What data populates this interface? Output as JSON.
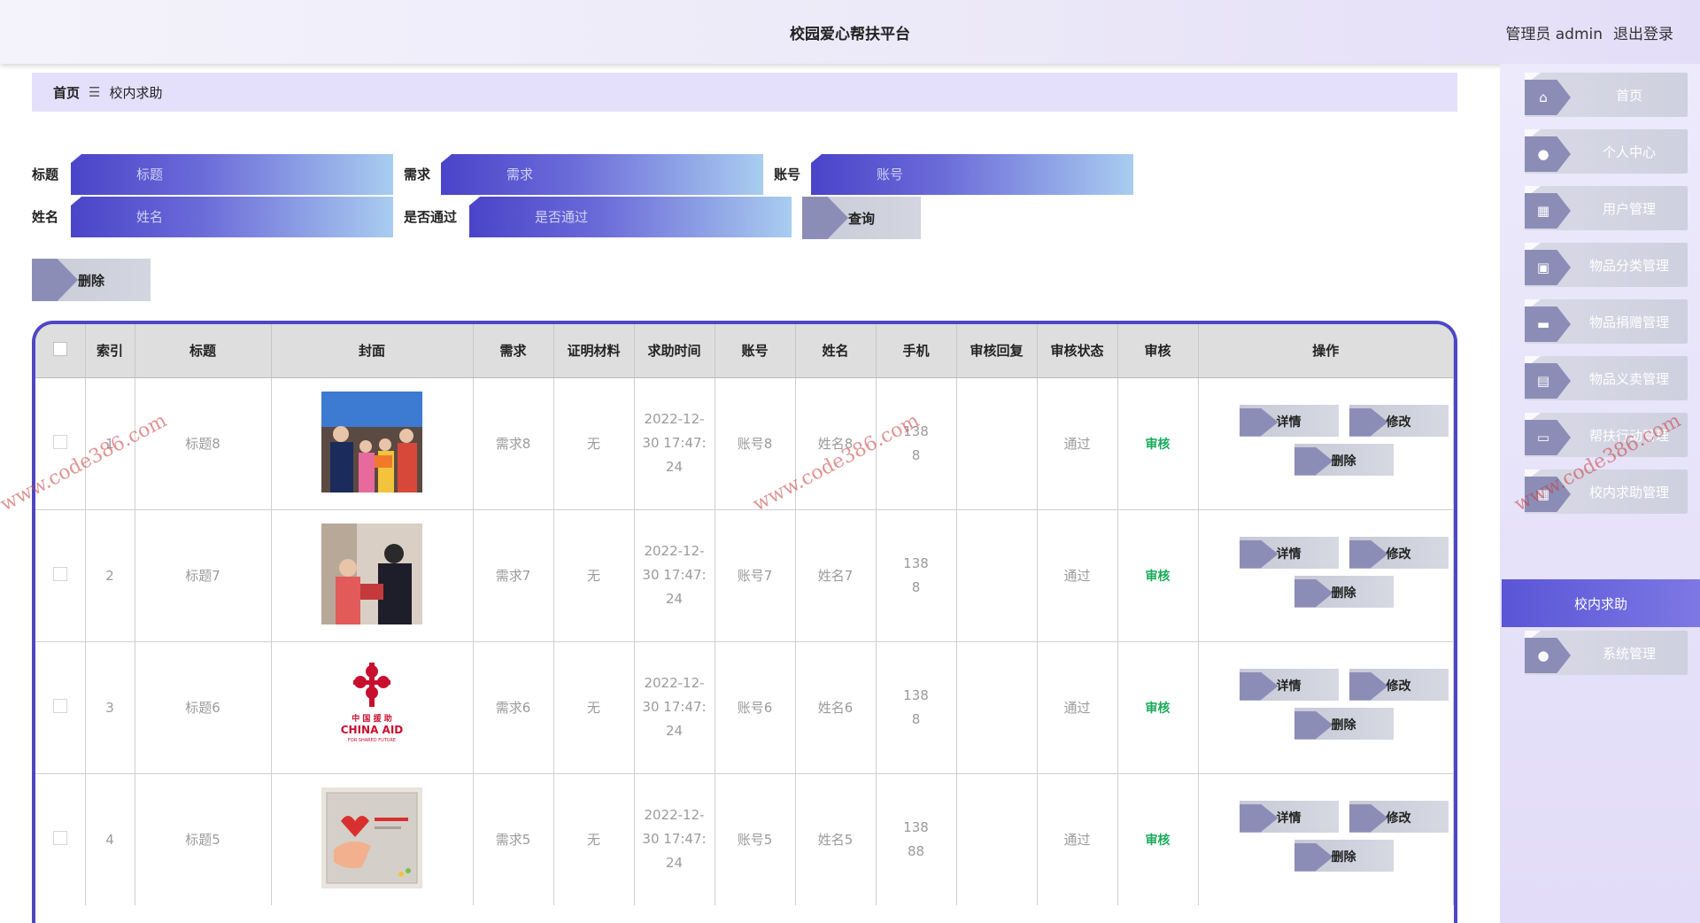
{
  "header": {
    "title": "校园爱心帮扶平台",
    "admin": "管理员 admin",
    "logout": "退出登录"
  },
  "sidebar": {
    "items": [
      {
        "label": "首页",
        "icon": "home-icon",
        "glyph": "⌂"
      },
      {
        "label": "个人中心",
        "icon": "user-icon",
        "glyph": "●"
      },
      {
        "label": "用户管理",
        "icon": "grid-icon",
        "glyph": "▦"
      },
      {
        "label": "物品分类管理",
        "icon": "category-icon",
        "glyph": "▣"
      },
      {
        "label": "物品捐赠管理",
        "icon": "briefcase-icon",
        "glyph": "▬"
      },
      {
        "label": "物品义卖管理",
        "icon": "document-icon",
        "glyph": "▤"
      },
      {
        "label": "帮扶行动管理",
        "icon": "monitor-icon",
        "glyph": "▭"
      },
      {
        "label": "校内求助管理",
        "icon": "grid-icon",
        "glyph": "▦"
      }
    ],
    "active": "校内求助",
    "system": {
      "label": "系统管理",
      "icon": "user-icon",
      "glyph": "●"
    }
  },
  "breadcrumb": {
    "home": "首页",
    "separator": "☰",
    "current": "校内求助"
  },
  "search": {
    "title": {
      "label": "标题",
      "placeholder": "标题"
    },
    "need": {
      "label": "需求",
      "placeholder": "需求"
    },
    "account": {
      "label": "账号",
      "placeholder": "账号"
    },
    "name": {
      "label": "姓名",
      "placeholder": "姓名"
    },
    "passed": {
      "label": "是否通过",
      "placeholder": "是否通过"
    },
    "query_button": "查询",
    "delete_button": "删除"
  },
  "table": {
    "headers": [
      "索引",
      "标题",
      "封面",
      "需求",
      "证明材料",
      "求助时间",
      "账号",
      "姓名",
      "手机",
      "审核回复",
      "审核状态",
      "审核",
      "操作"
    ],
    "rows": [
      {
        "index": "1",
        "title": "标题8",
        "cover": "cover-photo-1",
        "need": "需求8",
        "proof": "无",
        "time1": "2022-12-",
        "time2": "30 17:47:",
        "time3": "24",
        "account": "账号8",
        "name": "姓名8",
        "phone1": "138",
        "phone2": "8",
        "reply": "",
        "status": "通过",
        "audit": "审核"
      },
      {
        "index": "2",
        "title": "标题7",
        "cover": "cover-photo-2",
        "need": "需求7",
        "proof": "无",
        "time1": "2022-12-",
        "time2": "30 17:47:",
        "time3": "24",
        "account": "账号7",
        "name": "姓名7",
        "phone1": "138",
        "phone2": "8",
        "reply": "",
        "status": "通过",
        "audit": "审核"
      },
      {
        "index": "3",
        "title": "标题6",
        "cover": "chinaaid-logo",
        "need": "需求6",
        "proof": "无",
        "time1": "2022-12-",
        "time2": "30 17:47:",
        "time3": "24",
        "account": "账号6",
        "name": "姓名6",
        "phone1": "138",
        "phone2": "8",
        "reply": "",
        "status": "通过",
        "audit": "审核"
      },
      {
        "index": "4",
        "title": "标题5",
        "cover": "cover-poster-4",
        "need": "需求5",
        "proof": "无",
        "time1": "2022-12-",
        "time2": "30 17:47:",
        "time3": "24",
        "account": "账号5",
        "name": "姓名5",
        "phone1": "138",
        "phone2": "88",
        "reply": "",
        "status": "通过",
        "audit": "审核"
      }
    ],
    "ops": {
      "detail": "详情",
      "edit": "修改",
      "delete": "删除"
    }
  },
  "chinaaid": {
    "cn": "中 国 援 助",
    "en": "CHINA AID",
    "sub": "FOR SHARED FUTURE"
  },
  "watermark": "www.code386.com"
}
